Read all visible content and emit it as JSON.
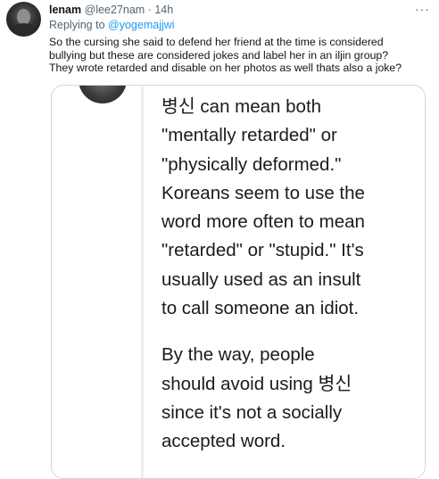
{
  "tweet": {
    "display_name": "lenam",
    "handle": "@lee27nam",
    "separator": "·",
    "time": "14h",
    "more_label": "···",
    "reply_prefix": "Replying to",
    "reply_to": "@yogemajjwi",
    "lines": [
      "So the cursing she said to defend her friend at the time is considered",
      "bullying but these are considered jokes and label her in an iljin group?",
      "They wrote retarded and disable on her photos as well thats also a joke?"
    ]
  },
  "media": {
    "paragraph1": [
      "병신 can mean both",
      "\"mentally retarded\" or",
      "\"physically deformed.\"",
      "Koreans seem to use the",
      "word more often to mean",
      "\"retarded\" or \"stupid.\" It's",
      "usually used as an insult",
      "to call someone an idiot."
    ],
    "paragraph2": [
      "By the way, people",
      "should avoid using 병신",
      "since it's not a socially",
      "accepted word."
    ]
  }
}
